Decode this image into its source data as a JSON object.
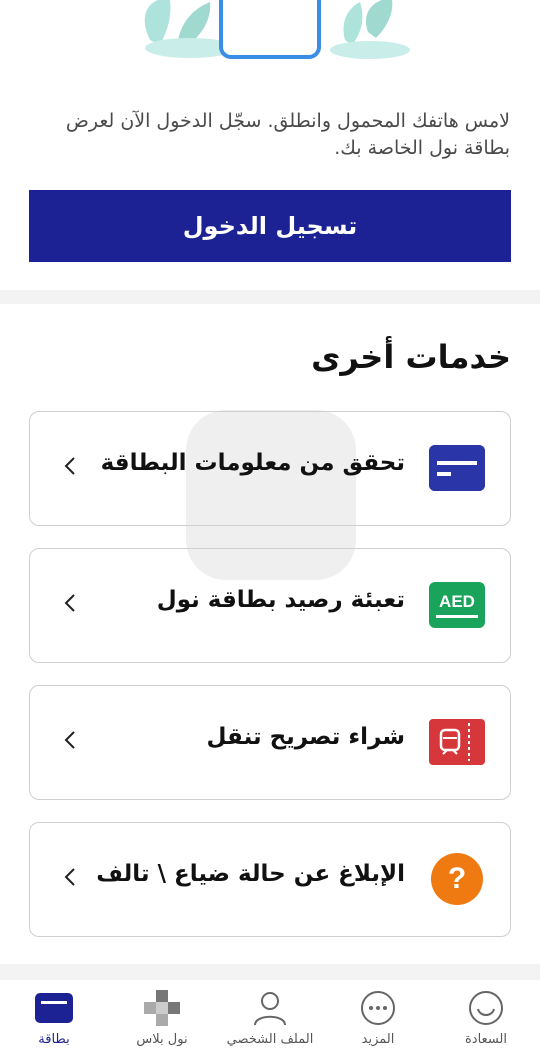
{
  "intro_text": "لامس هاتفك المحمول وانطلق. سجّل الدخول الآن لعرض بطاقة نول الخاصة بك.",
  "login_button": "تسجيل الدخول",
  "section_title": "خدمات أخرى",
  "services": [
    {
      "label": "تحقق من معلومات البطاقة",
      "icon": "card-icon",
      "color": "#2a35a8"
    },
    {
      "label": "تعبئة رصيد بطاقة نول",
      "icon": "aed-icon",
      "color": "#1aa35a",
      "icon_text": "AED"
    },
    {
      "label": "شراء تصريح تنقل",
      "icon": "ticket-icon",
      "color": "#d6373a"
    },
    {
      "label": "الإبلاغ عن حالة ضياع \\ تالف",
      "icon": "question-icon",
      "color": "#f07a12",
      "icon_text": "?"
    }
  ],
  "tabs": [
    {
      "label": "السعادة",
      "icon": "smile-icon"
    },
    {
      "label": "المزيد",
      "icon": "more-icon"
    },
    {
      "label": "الملف الشخصي",
      "icon": "profile-icon"
    },
    {
      "label": "نول بلاس",
      "icon": "nol-plus-icon"
    },
    {
      "label": "بطاقة",
      "icon": "card-tab-icon",
      "active": true
    }
  ],
  "colors": {
    "primary": "#1c2293",
    "accent_phone": "#3a8ee6",
    "plants": "#aee3dc"
  }
}
